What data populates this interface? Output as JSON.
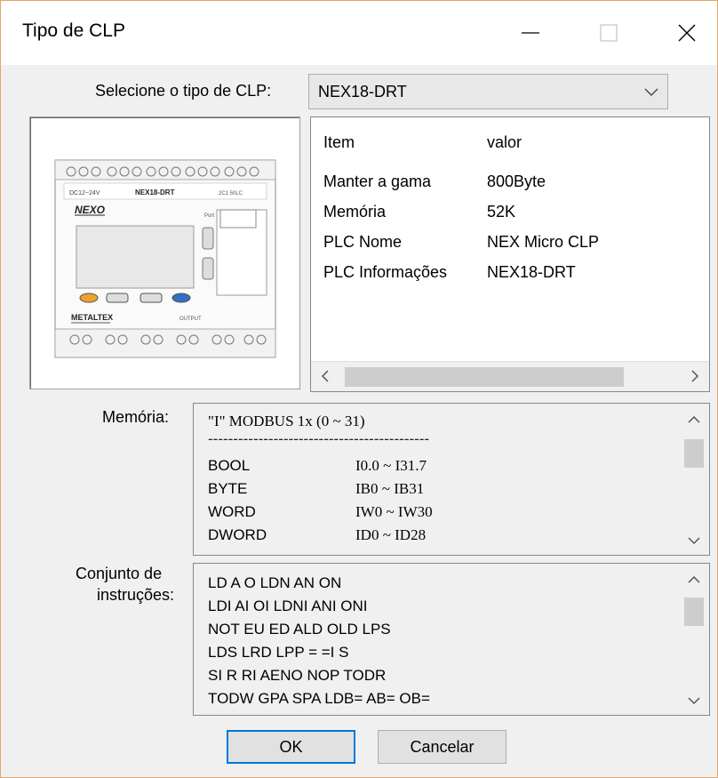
{
  "window": {
    "title": "Tipo de CLP"
  },
  "plc_type": {
    "label": "Selecione o tipo de CLP:",
    "selected": "NEX18-DRT"
  },
  "device_image": {
    "model": "NEX18-DRT",
    "brand": "NEXO",
    "manufacturer": "METALTEX"
  },
  "info_table": {
    "headers": {
      "item": "Item",
      "value": "valor"
    },
    "rows": [
      {
        "item": "Manter a gama",
        "value": "800Byte"
      },
      {
        "item": "Memória",
        "value": "52K"
      },
      {
        "item": "PLC Nome",
        "value": "NEX Micro CLP"
      },
      {
        "item": "PLC Informações",
        "value": "NEX18-DRT"
      }
    ]
  },
  "memory": {
    "label": "Memória:",
    "title": "\"I\" MODBUS 1x (0 ~ 31)",
    "separator": "--------------------------------------------",
    "rows": [
      {
        "type": "BOOL",
        "range": "I0.0 ~ I31.7"
      },
      {
        "type": "BYTE",
        "range": "IB0 ~ IB31"
      },
      {
        "type": "WORD",
        "range": "IW0 ~ IW30"
      },
      {
        "type": "DWORD",
        "range": "ID0 ~ ID28"
      }
    ]
  },
  "instructions": {
    "label_line1": "Conjunto de",
    "label_line2": "instruções:",
    "lines": [
      "LD A O LDN AN ON",
      "LDI AI OI LDNI ANI ONI",
      "NOT EU ED ALD OLD LPS",
      "LDS LRD LPP = =I S",
      "SI R RI AENO NOP TODR",
      "TODW GPA SPA LDB= AB= OB="
    ]
  },
  "buttons": {
    "ok": "OK",
    "cancel": "Cancelar"
  },
  "icons": {
    "minimize": "minimize-icon",
    "maximize": "maximize-icon",
    "close": "close-icon",
    "dropdown": "chevron-down-icon",
    "scroll_left": "chevron-left-icon",
    "scroll_right": "chevron-right-icon",
    "scroll_up": "chevron-up-icon",
    "scroll_down": "chevron-down-icon"
  },
  "colors": {
    "accent": "#0078d7",
    "window_border": "#e8a46a"
  }
}
